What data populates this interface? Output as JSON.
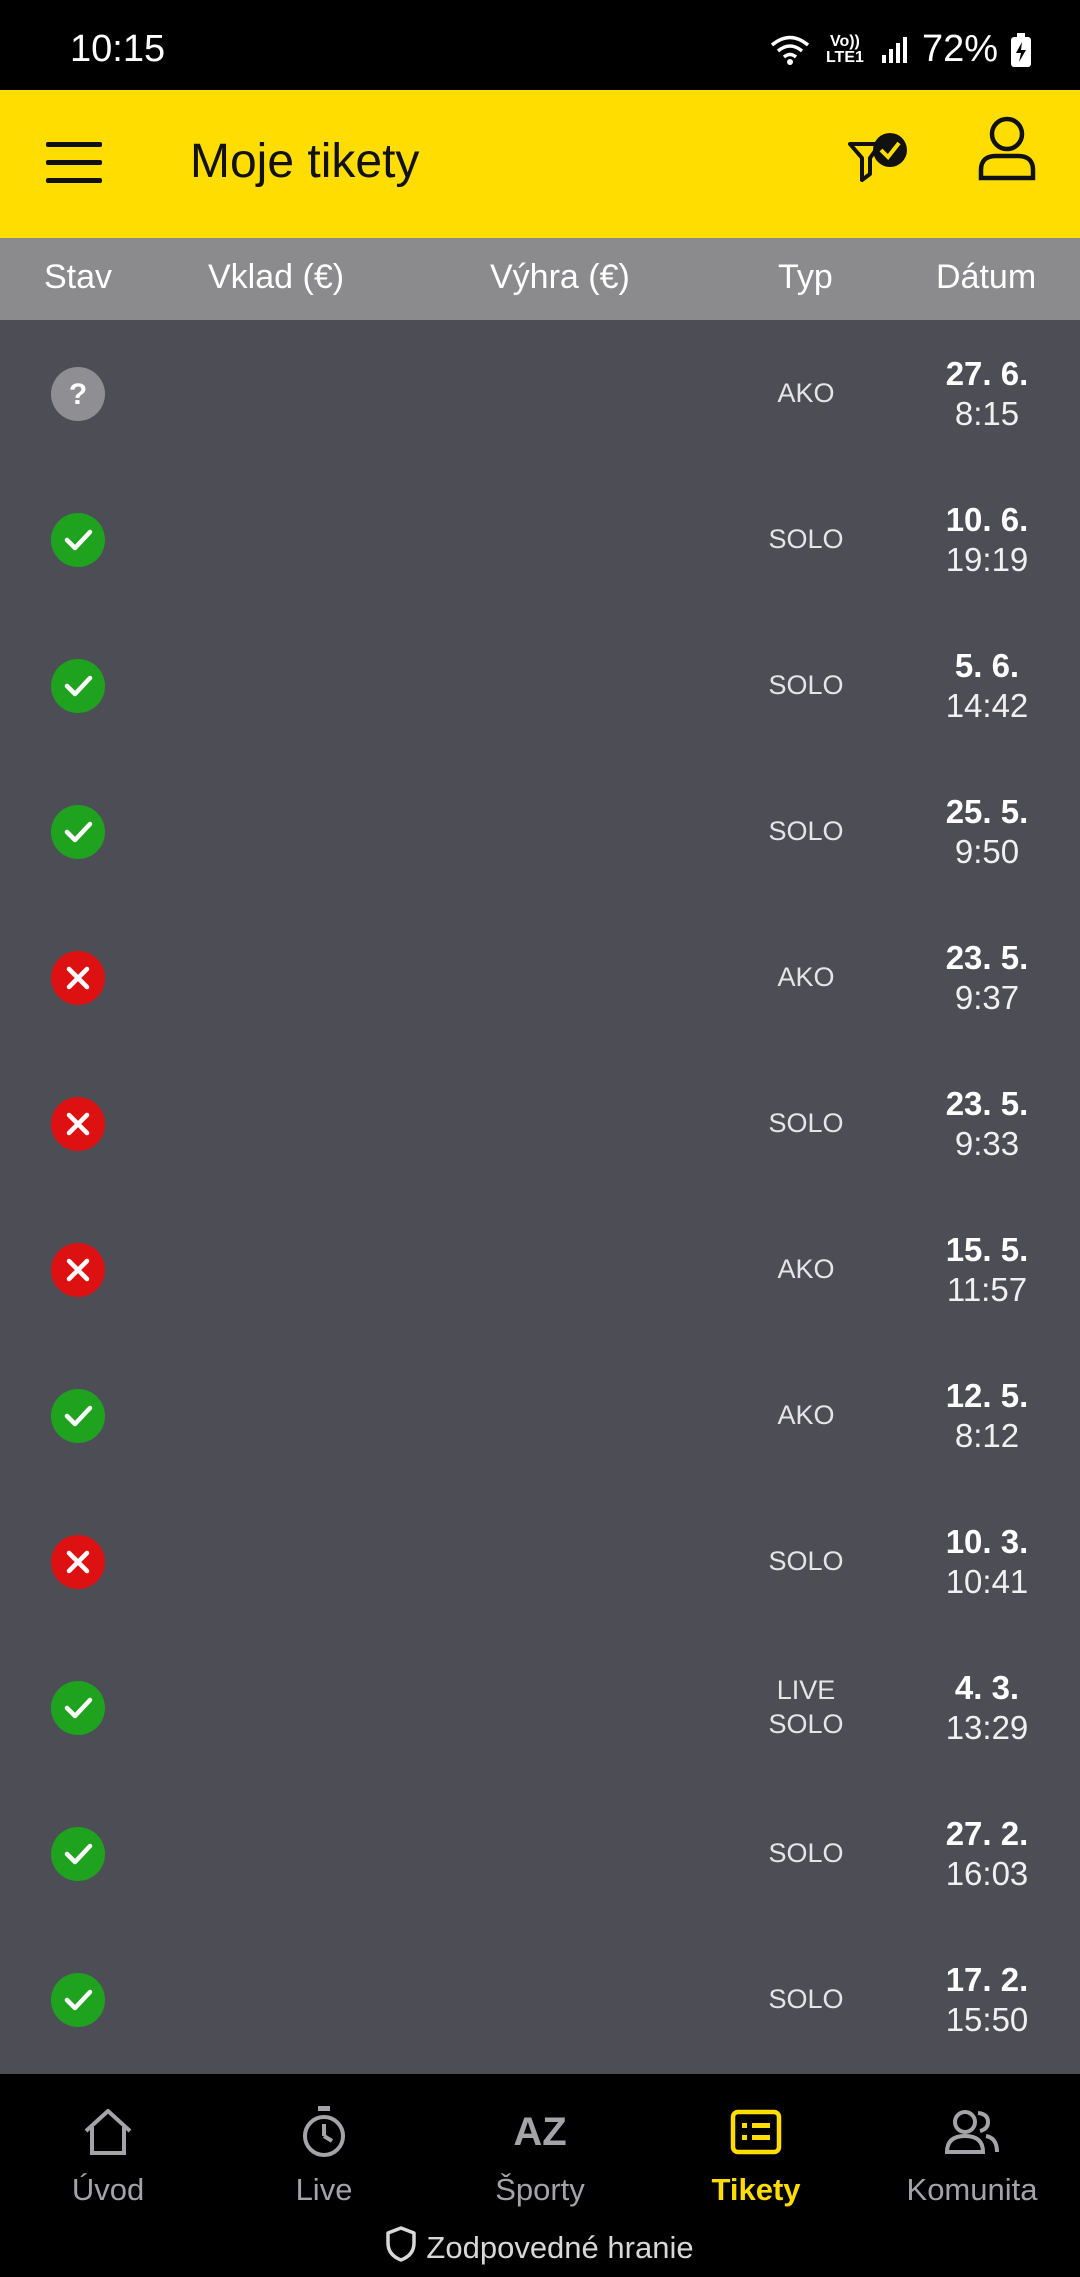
{
  "status_bar": {
    "time": "10:15",
    "network": "Vo)) LTE1",
    "battery": "72%"
  },
  "header": {
    "title": "Moje tikety"
  },
  "columns": {
    "stav": "Stav",
    "vklad": "Vklad (€)",
    "vyhra": "Výhra (€)",
    "typ": "Typ",
    "datum": "Dátum"
  },
  "tickets": [
    {
      "status": "pending",
      "typ": "AKO",
      "date": "27. 6.",
      "time": "8:15"
    },
    {
      "status": "won",
      "typ": "SOLO",
      "date": "10. 6.",
      "time": "19:19"
    },
    {
      "status": "won",
      "typ": "SOLO",
      "date": "5. 6.",
      "time": "14:42"
    },
    {
      "status": "won",
      "typ": "SOLO",
      "date": "25. 5.",
      "time": "9:50"
    },
    {
      "status": "lost",
      "typ": "AKO",
      "date": "23. 5.",
      "time": "9:37"
    },
    {
      "status": "lost",
      "typ": "SOLO",
      "date": "23. 5.",
      "time": "9:33"
    },
    {
      "status": "lost",
      "typ": "AKO",
      "date": "15. 5.",
      "time": "11:57"
    },
    {
      "status": "won",
      "typ": "AKO",
      "date": "12. 5.",
      "time": "8:12"
    },
    {
      "status": "lost",
      "typ": "SOLO",
      "date": "10. 3.",
      "time": "10:41"
    },
    {
      "status": "won",
      "typ": "LIVE\nSOLO",
      "date": "4. 3.",
      "time": "13:29"
    },
    {
      "status": "won",
      "typ": "SOLO",
      "date": "27. 2.",
      "time": "16:03"
    },
    {
      "status": "won",
      "typ": "SOLO",
      "date": "17. 2.",
      "time": "15:50"
    }
  ],
  "colors": {
    "won": "#1fa31f",
    "lost": "#dd1111",
    "pending": "#8e8e93",
    "accent": "#ffdd00"
  },
  "nav": [
    {
      "label": "Úvod",
      "icon": "home-icon"
    },
    {
      "label": "Live",
      "icon": "stopwatch-icon"
    },
    {
      "label": "Športy",
      "icon": "az-icon"
    },
    {
      "label": "Tikety",
      "icon": "ticket-icon",
      "active": true
    },
    {
      "label": "Komunita",
      "icon": "community-icon"
    }
  ],
  "nav_az_glyph": "AZ",
  "responsible": "Zodpovedné hranie"
}
